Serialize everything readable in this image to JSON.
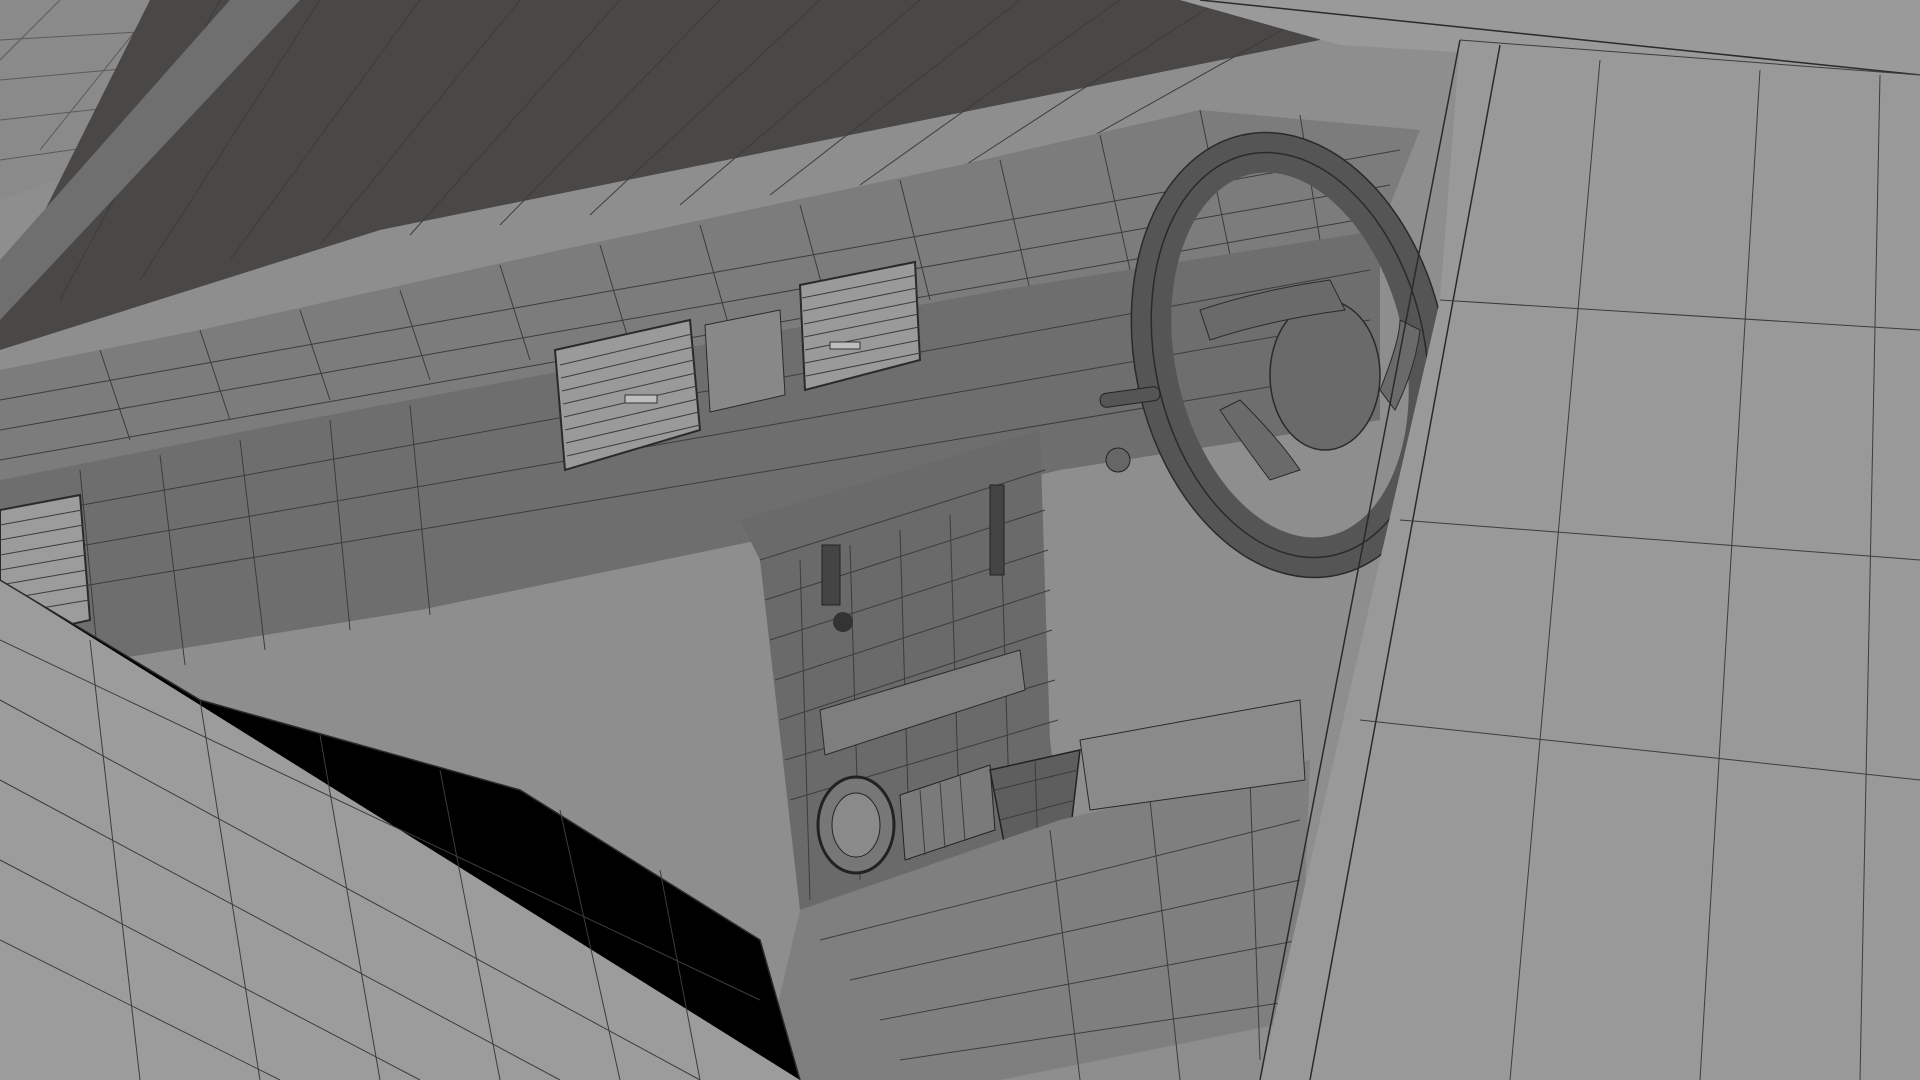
{
  "scene": {
    "subject": "car-interior-wireframe",
    "shading": "solid-gray-with-wireframe-overlay",
    "colors": {
      "background": "#8e8e8e",
      "ground": "#9a9a9a",
      "roof_dark": "#4a4846",
      "dash_top": "#7a7a7a",
      "dash_face": "#6e6e6e",
      "console": "#6a6a6a",
      "door_panel": "#9c9c9c",
      "pillar": "#999999",
      "wire": "#3c3c3c"
    }
  }
}
